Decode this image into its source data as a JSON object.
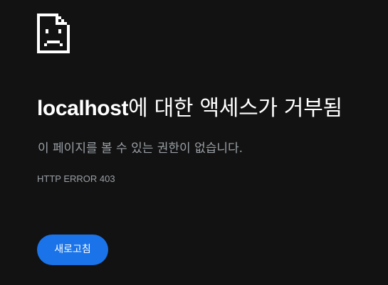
{
  "icon": "sad-page-icon",
  "headline": {
    "host": "localhost",
    "rest": "에 대한 액세스가 거부됨"
  },
  "summary": "이 페이지를 볼 수 있는 권한이 없습니다.",
  "error_code": "HTTP ERROR 403",
  "reload_button": "새로고침",
  "colors": {
    "background": "#121212",
    "text": "#ffffff",
    "secondary_text": "#9aa0a6",
    "button": "#1a73e8"
  }
}
